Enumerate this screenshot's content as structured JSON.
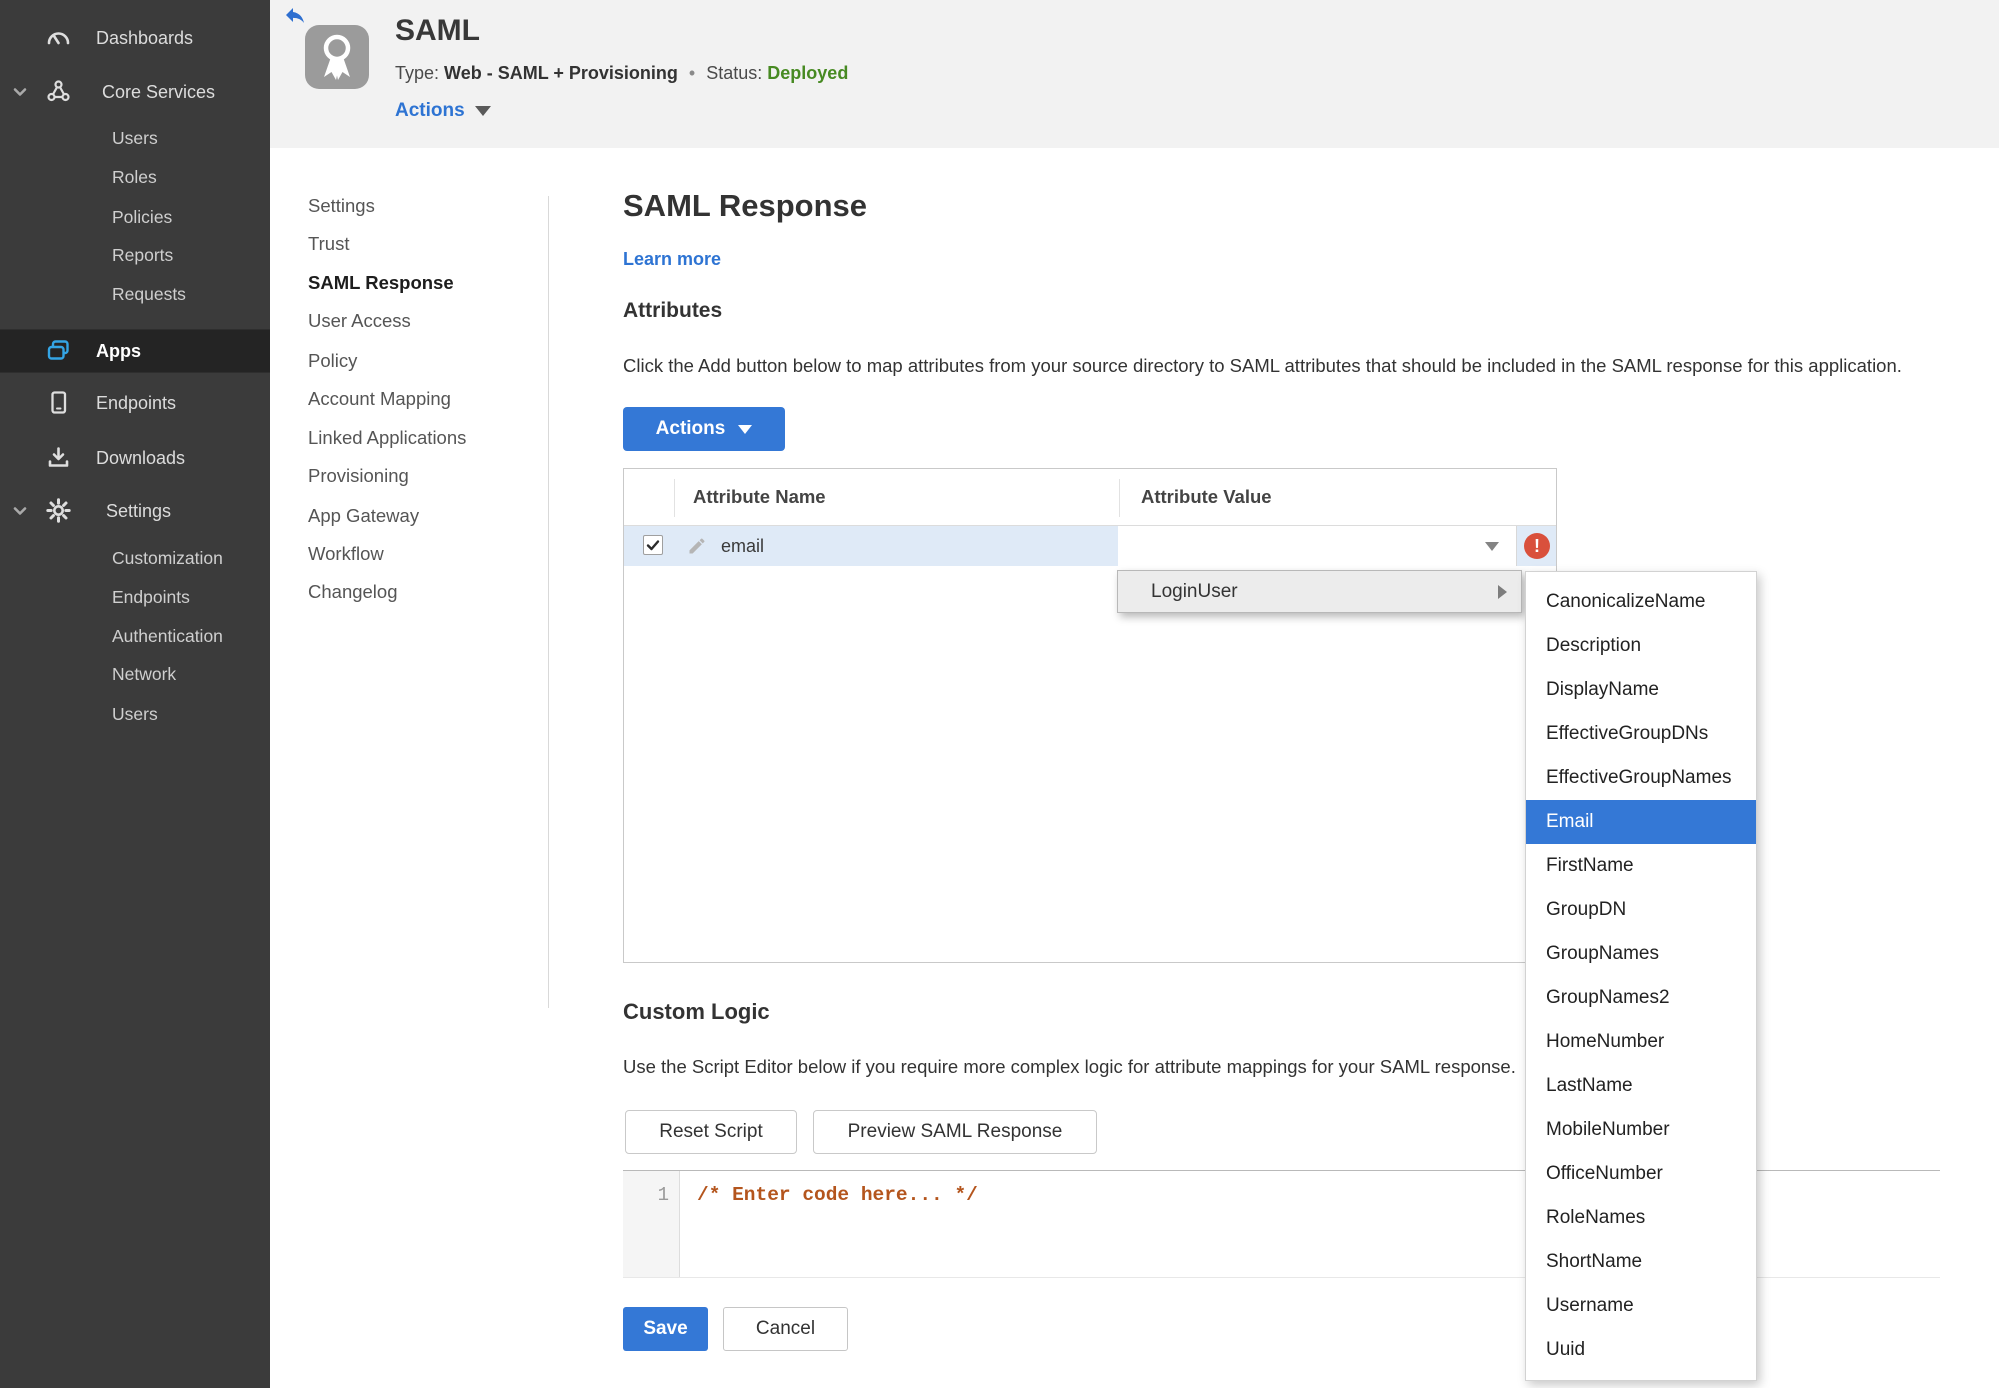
{
  "colors": {
    "accent_blue": "#3478d6",
    "link_blue": "#2e74d3",
    "status_green": "#478a22",
    "error_red": "#d9503c",
    "row_highlight": "#dfeaf7",
    "sidebar_bg": "#3b3b3b",
    "sidebar_active_bg": "#242424",
    "apps_icon_blue": "#34a5e5"
  },
  "sidebar": {
    "active": "Apps",
    "items": [
      {
        "label": "Dashboards",
        "icon": "gauge-icon"
      },
      {
        "label": "Core Services",
        "icon": "core-services-icon",
        "expanded": true,
        "children": [
          "Users",
          "Roles",
          "Policies",
          "Reports",
          "Requests"
        ]
      },
      {
        "label": "Apps",
        "icon": "apps-icon"
      },
      {
        "label": "Endpoints",
        "icon": "device-icon"
      },
      {
        "label": "Downloads",
        "icon": "download-icon"
      },
      {
        "label": "Settings",
        "icon": "gear-icon",
        "expanded": true,
        "children": [
          "Customization",
          "Endpoints",
          "Authentication",
          "Network",
          "Users"
        ]
      }
    ]
  },
  "header": {
    "back_icon": "back-arrow-icon",
    "app_icon": "award-badge-icon",
    "app_title": "SAML",
    "type_label": "Type:",
    "type_value": "Web - SAML + Provisioning",
    "separator": "•",
    "status_label": "Status:",
    "status_value": "Deployed",
    "actions_label": "Actions"
  },
  "subnav": {
    "active": "SAML Response",
    "items": [
      "Settings",
      "Trust",
      "SAML Response",
      "User Access",
      "Policy",
      "Account Mapping",
      "Linked Applications",
      "Provisioning",
      "App Gateway",
      "Workflow",
      "Changelog"
    ]
  },
  "main": {
    "page_title": "SAML Response",
    "learn_more_label": "Learn more",
    "attributes": {
      "heading": "Attributes",
      "description": "Click the Add button below to map attributes from your source directory to SAML attributes that should be included in the SAML response for this application.",
      "actions_button_label": "Actions",
      "table": {
        "columns": [
          "Attribute Name",
          "Attribute Value"
        ],
        "rows": [
          {
            "checked": true,
            "attribute_name": "email",
            "attribute_value": "",
            "error": true
          }
        ]
      }
    },
    "value_menu": {
      "label": "LoginUser",
      "submenu": {
        "selected": "Email",
        "items": [
          "CanonicalizeName",
          "Description",
          "DisplayName",
          "EffectiveGroupDNs",
          "EffectiveGroupNames",
          "Email",
          "FirstName",
          "GroupDN",
          "GroupNames",
          "GroupNames2",
          "HomeNumber",
          "LastName",
          "MobileNumber",
          "OfficeNumber",
          "RoleNames",
          "ShortName",
          "Username",
          "Uuid"
        ]
      }
    },
    "custom_logic": {
      "heading": "Custom Logic",
      "description": "Use the Script Editor below if you require more complex logic for attribute mappings for your SAML response.",
      "reset_button_label": "Reset Script",
      "preview_button_label": "Preview SAML Response",
      "editor": {
        "line_number": "1",
        "code": "/* Enter code here... */"
      }
    },
    "footer": {
      "save_label": "Save",
      "cancel_label": "Cancel"
    }
  }
}
